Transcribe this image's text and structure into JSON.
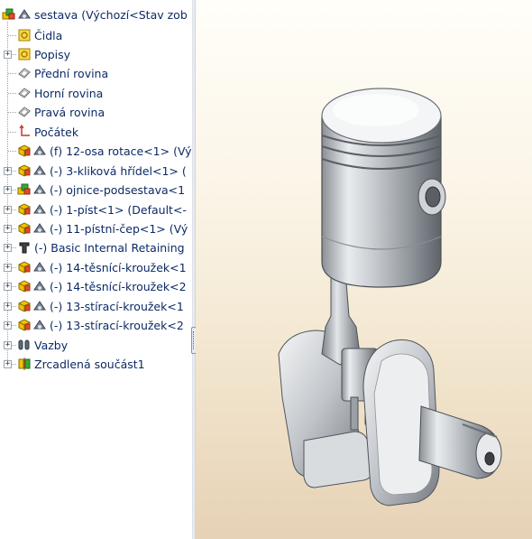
{
  "tree": {
    "root": {
      "label": "sestava  (Výchozí<Stav zob",
      "icon": "assembly-icon"
    },
    "items": [
      {
        "label": "Čidla",
        "icon": "sensors-icon",
        "expander": false,
        "kind": "folder"
      },
      {
        "label": "Popisy",
        "icon": "annotations-icon",
        "expander": true,
        "kind": "folder"
      },
      {
        "label": "Přední rovina",
        "icon": "plane-icon",
        "expander": false,
        "kind": "plane"
      },
      {
        "label": "Horní rovina",
        "icon": "plane-icon",
        "expander": false,
        "kind": "plane"
      },
      {
        "label": "Pravá rovina",
        "icon": "plane-icon",
        "expander": false,
        "kind": "plane"
      },
      {
        "label": "Počátek",
        "icon": "origin-icon",
        "expander": false,
        "kind": "origin"
      },
      {
        "label": "(f) 12-osa rotace<1> (Vý",
        "icon": "part-icon",
        "expander": false,
        "kind": "part"
      },
      {
        "label": "(-) 3-kliková hřídel<1> (",
        "icon": "part-icon",
        "expander": true,
        "kind": "part"
      },
      {
        "label": "(-) ojnice-podsestava<1",
        "icon": "subassembly-icon",
        "expander": true,
        "kind": "subasm"
      },
      {
        "label": "(-) 1-píst<1> (Default<-",
        "icon": "part-icon",
        "expander": true,
        "kind": "part"
      },
      {
        "label": "(-) 11-pístní-čep<1> (Vý",
        "icon": "part-icon",
        "expander": true,
        "kind": "part"
      },
      {
        "label": "(-) Basic Internal Retaining",
        "icon": "toolbox-part-icon",
        "expander": true,
        "kind": "toolbox"
      },
      {
        "label": "(-) 14-těsnící-kroužek<1",
        "icon": "part-icon",
        "expander": true,
        "kind": "part"
      },
      {
        "label": "(-) 14-těsnící-kroužek<2",
        "icon": "part-icon",
        "expander": true,
        "kind": "part"
      },
      {
        "label": "(-) 13-stírací-kroužek<1",
        "icon": "part-icon",
        "expander": true,
        "kind": "part"
      },
      {
        "label": "(-) 13-stírací-kroužek<2",
        "icon": "part-icon",
        "expander": true,
        "kind": "part"
      },
      {
        "label": "Vazby",
        "icon": "mates-icon",
        "expander": true,
        "kind": "mates"
      },
      {
        "label": "Zrcadlená součást1",
        "icon": "mirror-component-icon",
        "expander": true,
        "kind": "mirror"
      }
    ]
  },
  "viewport": {
    "model": "piston-crankshaft-assembly"
  },
  "colors": {
    "tree_text": "#0c2a66",
    "part_yellow": "#f2c400",
    "part_green": "#38a838"
  }
}
